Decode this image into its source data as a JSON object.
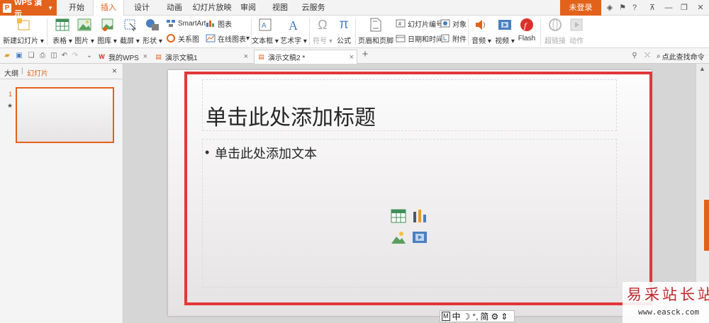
{
  "app": {
    "name": "WPS 演示"
  },
  "menu": {
    "tabs": [
      "开始",
      "插入",
      "设计",
      "动画",
      "幻灯片放映",
      "审阅",
      "视图",
      "云服务"
    ],
    "active": "插入",
    "login": "未登录"
  },
  "ribbon": {
    "new_slide": "新建幻灯片",
    "table": "表格",
    "image": "图片",
    "gallery": "图库",
    "screenshot": "截屏",
    "shape": "形状",
    "smartart": "SmartArt",
    "chart": "图表",
    "relation": "关系图",
    "online_chart": "在线图表",
    "textbox": "文本框",
    "wordart": "艺术字",
    "symbol": "符号",
    "formula": "公式",
    "header_footer": "页眉和页脚",
    "slide_number": "幻灯片编号",
    "datetime": "日期和时间",
    "object": "对象",
    "attachment": "附件",
    "audio": "音频",
    "video": "视频",
    "flash": "Flash",
    "hyperlink": "超链接",
    "action": "动作"
  },
  "doc_tabs": [
    {
      "label": "我的WPS"
    },
    {
      "label": "演示文稿1"
    },
    {
      "label": "演示文稿2 *"
    }
  ],
  "search_cmd": "点此查找命令",
  "left_panel": {
    "tab_outline": "大纲",
    "tab_slides": "幻灯片",
    "slide_number": "1",
    "star": "★"
  },
  "slide": {
    "title_placeholder": "单击此处添加标题",
    "body_placeholder": "单击此处添加文本",
    "bullet": "•"
  },
  "ime": {
    "items": [
      "M",
      "中",
      "☽",
      "°,",
      "简",
      "⚙",
      "⇕"
    ]
  },
  "watermark": {
    "text": "易采站长站",
    "url": "www.easck.com"
  },
  "colors": {
    "accent": "#e2621b",
    "highlight": "#e2373a"
  }
}
